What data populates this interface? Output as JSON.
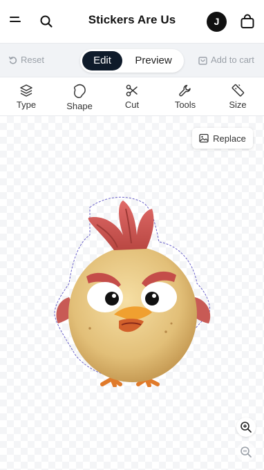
{
  "header": {
    "title": "Stickers Are Us",
    "avatar_initial": "J",
    "icons": {
      "menu": "menu-icon",
      "search": "search-icon",
      "cart": "shopping-bag-icon"
    }
  },
  "modebar": {
    "reset_label": "Reset",
    "tabs": [
      {
        "label": "Edit",
        "active": true
      },
      {
        "label": "Preview",
        "active": false
      }
    ],
    "add_to_cart_label": "Add to cart"
  },
  "tools": [
    {
      "label": "Type",
      "icon": "layers-icon"
    },
    {
      "label": "Shape",
      "icon": "blob-shape-icon"
    },
    {
      "label": "Cut",
      "icon": "scissors-icon"
    },
    {
      "label": "Tools",
      "icon": "wrench-icon"
    },
    {
      "label": "Size",
      "icon": "ruler-icon"
    }
  ],
  "canvas": {
    "replace_label": "Replace",
    "sticker_subject": "angry cartoon chick sticker",
    "zoom": {
      "in_icon": "zoom-in-icon",
      "out_icon": "zoom-out-icon"
    }
  },
  "colors": {
    "accent_dark": "#0f1b2a",
    "bar_bg": "#f1f3f6",
    "muted_text": "#9aa0a8",
    "cut_line": "#6b62c9"
  }
}
